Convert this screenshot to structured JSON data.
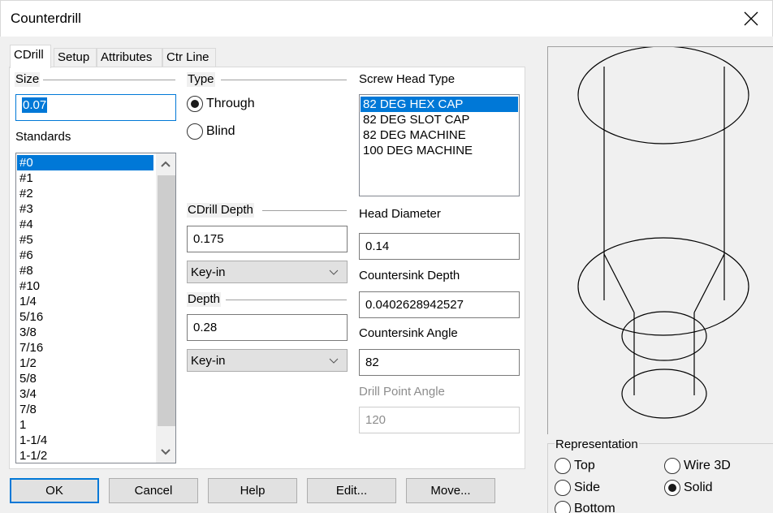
{
  "window": {
    "title": "Counterdrill",
    "close_icon": "close-icon"
  },
  "tabs": [
    {
      "label": "CDrill",
      "active": true
    },
    {
      "label": "Setup",
      "active": false
    },
    {
      "label": "Attributes",
      "active": false
    },
    {
      "label": "Ctr Line",
      "active": false
    }
  ],
  "size": {
    "label": "Size",
    "value": "0.07"
  },
  "standards": {
    "label": "Standards",
    "items": [
      "#0",
      "#1",
      "#2",
      "#3",
      "#4",
      "#5",
      "#6",
      "#8",
      "#10",
      "1/4",
      "5/16",
      "3/8",
      "7/16",
      "1/2",
      "5/8",
      "3/4",
      "7/8",
      "1",
      "1-1/4",
      "1-1/2"
    ],
    "selected": "#0"
  },
  "type": {
    "label": "Type",
    "options": [
      {
        "label": "Through",
        "checked": true
      },
      {
        "label": "Blind",
        "checked": false
      }
    ]
  },
  "cdrill_depth": {
    "label": "CDrill Depth",
    "value": "0.175",
    "mode": "Key-in"
  },
  "depth": {
    "label": "Depth",
    "value": "0.28",
    "mode": "Key-in"
  },
  "screw_head_type": {
    "label": "Screw Head Type",
    "items": [
      "82 DEG HEX CAP",
      "82 DEG SLOT CAP",
      "82 DEG MACHINE",
      "100 DEG MACHINE"
    ],
    "selected": "82 DEG HEX CAP"
  },
  "head_diameter": {
    "label": "Head Diameter",
    "value": "0.14"
  },
  "countersink_depth": {
    "label": "Countersink Depth",
    "value": "0.0402628942527"
  },
  "countersink_angle": {
    "label": "Countersink Angle",
    "value": "82"
  },
  "drill_point_angle": {
    "label": "Drill Point Angle",
    "value": "120",
    "disabled": true
  },
  "representation": {
    "label": "Representation",
    "options": [
      {
        "label": "Top",
        "checked": false
      },
      {
        "label": "Wire 3D",
        "checked": false
      },
      {
        "label": "Side",
        "checked": false
      },
      {
        "label": "Solid",
        "checked": true
      },
      {
        "label": "Bottom",
        "checked": false
      }
    ]
  },
  "buttons": {
    "ok": "OK",
    "cancel": "Cancel",
    "help": "Help",
    "edit": "Edit...",
    "move": "Move..."
  },
  "colors": {
    "accent": "#0078d7",
    "window_bg": "#f0f0f0",
    "disabled_text": "#8d8d8d"
  }
}
